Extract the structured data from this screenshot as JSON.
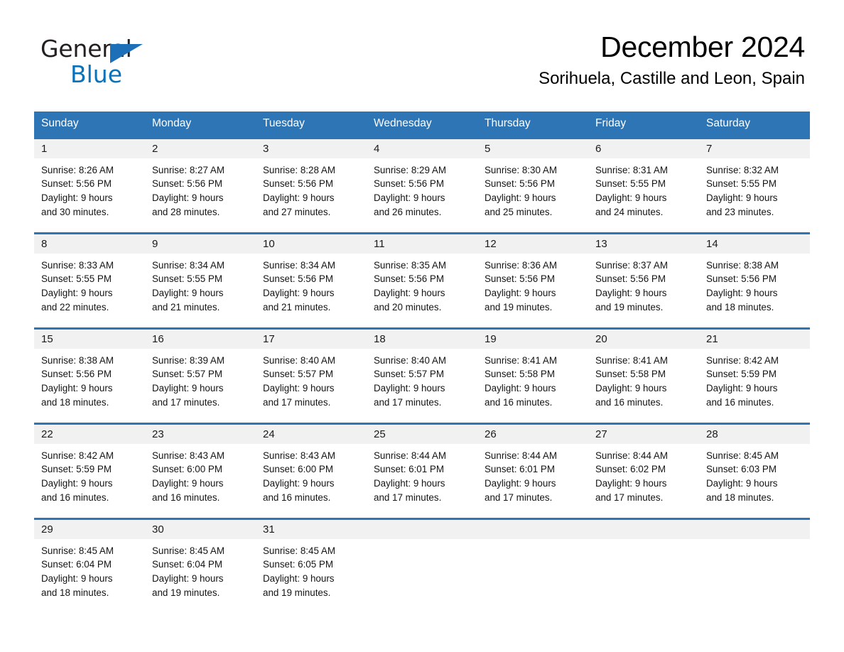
{
  "brand": {
    "name_part1": "General",
    "name_part2": "Blue",
    "flag_icon": "triangle-flag-icon",
    "accent_color": "#1d70b7"
  },
  "header": {
    "title": "December 2024",
    "subtitle": "Sorihuela, Castille and Leon, Spain",
    "header_bg": "#2e75b6",
    "row_border": "#2e75b6",
    "daynum_bg": "#f1f1f1"
  },
  "weekdays": [
    "Sunday",
    "Monday",
    "Tuesday",
    "Wednesday",
    "Thursday",
    "Friday",
    "Saturday"
  ],
  "weeks": [
    [
      {
        "day": "1",
        "sunrise": "Sunrise: 8:26 AM",
        "sunset": "Sunset: 5:56 PM",
        "daylight_line1": "Daylight: 9 hours",
        "daylight_line2": "and 30 minutes."
      },
      {
        "day": "2",
        "sunrise": "Sunrise: 8:27 AM",
        "sunset": "Sunset: 5:56 PM",
        "daylight_line1": "Daylight: 9 hours",
        "daylight_line2": "and 28 minutes."
      },
      {
        "day": "3",
        "sunrise": "Sunrise: 8:28 AM",
        "sunset": "Sunset: 5:56 PM",
        "daylight_line1": "Daylight: 9 hours",
        "daylight_line2": "and 27 minutes."
      },
      {
        "day": "4",
        "sunrise": "Sunrise: 8:29 AM",
        "sunset": "Sunset: 5:56 PM",
        "daylight_line1": "Daylight: 9 hours",
        "daylight_line2": "and 26 minutes."
      },
      {
        "day": "5",
        "sunrise": "Sunrise: 8:30 AM",
        "sunset": "Sunset: 5:56 PM",
        "daylight_line1": "Daylight: 9 hours",
        "daylight_line2": "and 25 minutes."
      },
      {
        "day": "6",
        "sunrise": "Sunrise: 8:31 AM",
        "sunset": "Sunset: 5:55 PM",
        "daylight_line1": "Daylight: 9 hours",
        "daylight_line2": "and 24 minutes."
      },
      {
        "day": "7",
        "sunrise": "Sunrise: 8:32 AM",
        "sunset": "Sunset: 5:55 PM",
        "daylight_line1": "Daylight: 9 hours",
        "daylight_line2": "and 23 minutes."
      }
    ],
    [
      {
        "day": "8",
        "sunrise": "Sunrise: 8:33 AM",
        "sunset": "Sunset: 5:55 PM",
        "daylight_line1": "Daylight: 9 hours",
        "daylight_line2": "and 22 minutes."
      },
      {
        "day": "9",
        "sunrise": "Sunrise: 8:34 AM",
        "sunset": "Sunset: 5:55 PM",
        "daylight_line1": "Daylight: 9 hours",
        "daylight_line2": "and 21 minutes."
      },
      {
        "day": "10",
        "sunrise": "Sunrise: 8:34 AM",
        "sunset": "Sunset: 5:56 PM",
        "daylight_line1": "Daylight: 9 hours",
        "daylight_line2": "and 21 minutes."
      },
      {
        "day": "11",
        "sunrise": "Sunrise: 8:35 AM",
        "sunset": "Sunset: 5:56 PM",
        "daylight_line1": "Daylight: 9 hours",
        "daylight_line2": "and 20 minutes."
      },
      {
        "day": "12",
        "sunrise": "Sunrise: 8:36 AM",
        "sunset": "Sunset: 5:56 PM",
        "daylight_line1": "Daylight: 9 hours",
        "daylight_line2": "and 19 minutes."
      },
      {
        "day": "13",
        "sunrise": "Sunrise: 8:37 AM",
        "sunset": "Sunset: 5:56 PM",
        "daylight_line1": "Daylight: 9 hours",
        "daylight_line2": "and 19 minutes."
      },
      {
        "day": "14",
        "sunrise": "Sunrise: 8:38 AM",
        "sunset": "Sunset: 5:56 PM",
        "daylight_line1": "Daylight: 9 hours",
        "daylight_line2": "and 18 minutes."
      }
    ],
    [
      {
        "day": "15",
        "sunrise": "Sunrise: 8:38 AM",
        "sunset": "Sunset: 5:56 PM",
        "daylight_line1": "Daylight: 9 hours",
        "daylight_line2": "and 18 minutes."
      },
      {
        "day": "16",
        "sunrise": "Sunrise: 8:39 AM",
        "sunset": "Sunset: 5:57 PM",
        "daylight_line1": "Daylight: 9 hours",
        "daylight_line2": "and 17 minutes."
      },
      {
        "day": "17",
        "sunrise": "Sunrise: 8:40 AM",
        "sunset": "Sunset: 5:57 PM",
        "daylight_line1": "Daylight: 9 hours",
        "daylight_line2": "and 17 minutes."
      },
      {
        "day": "18",
        "sunrise": "Sunrise: 8:40 AM",
        "sunset": "Sunset: 5:57 PM",
        "daylight_line1": "Daylight: 9 hours",
        "daylight_line2": "and 17 minutes."
      },
      {
        "day": "19",
        "sunrise": "Sunrise: 8:41 AM",
        "sunset": "Sunset: 5:58 PM",
        "daylight_line1": "Daylight: 9 hours",
        "daylight_line2": "and 16 minutes."
      },
      {
        "day": "20",
        "sunrise": "Sunrise: 8:41 AM",
        "sunset": "Sunset: 5:58 PM",
        "daylight_line1": "Daylight: 9 hours",
        "daylight_line2": "and 16 minutes."
      },
      {
        "day": "21",
        "sunrise": "Sunrise: 8:42 AM",
        "sunset": "Sunset: 5:59 PM",
        "daylight_line1": "Daylight: 9 hours",
        "daylight_line2": "and 16 minutes."
      }
    ],
    [
      {
        "day": "22",
        "sunrise": "Sunrise: 8:42 AM",
        "sunset": "Sunset: 5:59 PM",
        "daylight_line1": "Daylight: 9 hours",
        "daylight_line2": "and 16 minutes."
      },
      {
        "day": "23",
        "sunrise": "Sunrise: 8:43 AM",
        "sunset": "Sunset: 6:00 PM",
        "daylight_line1": "Daylight: 9 hours",
        "daylight_line2": "and 16 minutes."
      },
      {
        "day": "24",
        "sunrise": "Sunrise: 8:43 AM",
        "sunset": "Sunset: 6:00 PM",
        "daylight_line1": "Daylight: 9 hours",
        "daylight_line2": "and 16 minutes."
      },
      {
        "day": "25",
        "sunrise": "Sunrise: 8:44 AM",
        "sunset": "Sunset: 6:01 PM",
        "daylight_line1": "Daylight: 9 hours",
        "daylight_line2": "and 17 minutes."
      },
      {
        "day": "26",
        "sunrise": "Sunrise: 8:44 AM",
        "sunset": "Sunset: 6:01 PM",
        "daylight_line1": "Daylight: 9 hours",
        "daylight_line2": "and 17 minutes."
      },
      {
        "day": "27",
        "sunrise": "Sunrise: 8:44 AM",
        "sunset": "Sunset: 6:02 PM",
        "daylight_line1": "Daylight: 9 hours",
        "daylight_line2": "and 17 minutes."
      },
      {
        "day": "28",
        "sunrise": "Sunrise: 8:45 AM",
        "sunset": "Sunset: 6:03 PM",
        "daylight_line1": "Daylight: 9 hours",
        "daylight_line2": "and 18 minutes."
      }
    ],
    [
      {
        "day": "29",
        "sunrise": "Sunrise: 8:45 AM",
        "sunset": "Sunset: 6:04 PM",
        "daylight_line1": "Daylight: 9 hours",
        "daylight_line2": "and 18 minutes."
      },
      {
        "day": "30",
        "sunrise": "Sunrise: 8:45 AM",
        "sunset": "Sunset: 6:04 PM",
        "daylight_line1": "Daylight: 9 hours",
        "daylight_line2": "and 19 minutes."
      },
      {
        "day": "31",
        "sunrise": "Sunrise: 8:45 AM",
        "sunset": "Sunset: 6:05 PM",
        "daylight_line1": "Daylight: 9 hours",
        "daylight_line2": "and 19 minutes."
      },
      {
        "day": "",
        "sunrise": "",
        "sunset": "",
        "daylight_line1": "",
        "daylight_line2": ""
      },
      {
        "day": "",
        "sunrise": "",
        "sunset": "",
        "daylight_line1": "",
        "daylight_line2": ""
      },
      {
        "day": "",
        "sunrise": "",
        "sunset": "",
        "daylight_line1": "",
        "daylight_line2": ""
      },
      {
        "day": "",
        "sunrise": "",
        "sunset": "",
        "daylight_line1": "",
        "daylight_line2": ""
      }
    ]
  ]
}
